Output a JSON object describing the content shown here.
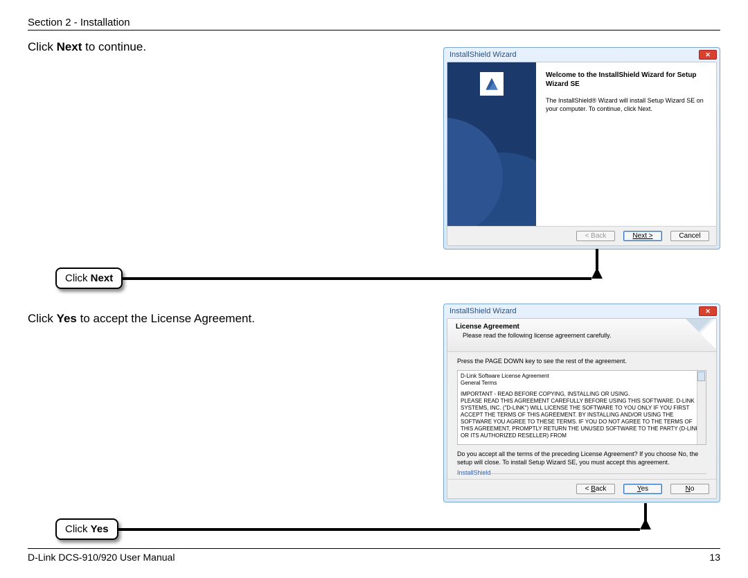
{
  "header": "Section 2 - Installation",
  "instruction1_pre": "Click ",
  "instruction1_bold": "Next",
  "instruction1_post": " to continue.",
  "instruction2_pre": "Click ",
  "instruction2_bold": "Yes",
  "instruction2_post": " to accept the License Agreement.",
  "callout1_pre": "Click ",
  "callout1_bold": "Next",
  "callout2_pre": "Click ",
  "callout2_bold": "Yes",
  "footer_left": "D-Link DCS-910/920 User Manual",
  "footer_right": "13",
  "dialog1": {
    "title": "InstallShield Wizard",
    "heading": "Welcome to the InstallShield Wizard for Setup Wizard SE",
    "body": "The InstallShield® Wizard will install Setup Wizard SE on your computer. To continue, click Next.",
    "back": "< Back",
    "next": "Next >",
    "cancel": "Cancel"
  },
  "dialog2": {
    "title": "InstallShield Wizard",
    "head_title": "License Agreement",
    "head_sub": "Please read the following license agreement carefully.",
    "hint": "Press the PAGE DOWN key to see the rest of the agreement.",
    "license_l1": "D-Link Software License Agreement",
    "license_l2": "General Terms",
    "license_body": "IMPORTANT - READ BEFORE COPYING, INSTALLING OR USING.\nPLEASE READ THIS AGREEMENT CAREFULLY BEFORE USING THIS SOFTWARE. D-LINK SYSTEMS, INC. (\"D-LINK\") WILL LICENSE THE SOFTWARE TO YOU ONLY IF YOU FIRST ACCEPT THE TERMS OF THIS AGREEMENT. BY INSTALLING AND/OR USING THE SOFTWARE YOU AGREE TO THESE TERMS. IF YOU DO NOT AGREE TO THE TERMS OF THIS AGREEMENT, PROMPTLY RETURN THE UNUSED SOFTWARE TO THE PARTY (D-LINK OR ITS AUTHORIZED RESELLER) FROM",
    "accept_q": "Do you accept all the terms of the preceding License Agreement? If you choose No, the setup will close. To install Setup Wizard SE, you must accept this agreement.",
    "ishield": "InstallShield",
    "back": "< Back",
    "yes": "Yes",
    "no": "No"
  }
}
